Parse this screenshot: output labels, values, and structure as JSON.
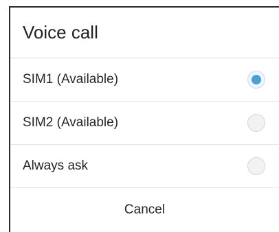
{
  "dialog": {
    "title": "Voice call",
    "options": [
      {
        "label": "SIM1 (Available)",
        "selected": true
      },
      {
        "label": "SIM2 (Available)",
        "selected": false
      },
      {
        "label": "Always ask",
        "selected": false
      }
    ],
    "cancel_label": "Cancel"
  },
  "colors": {
    "accent": "#4a9fd8"
  }
}
